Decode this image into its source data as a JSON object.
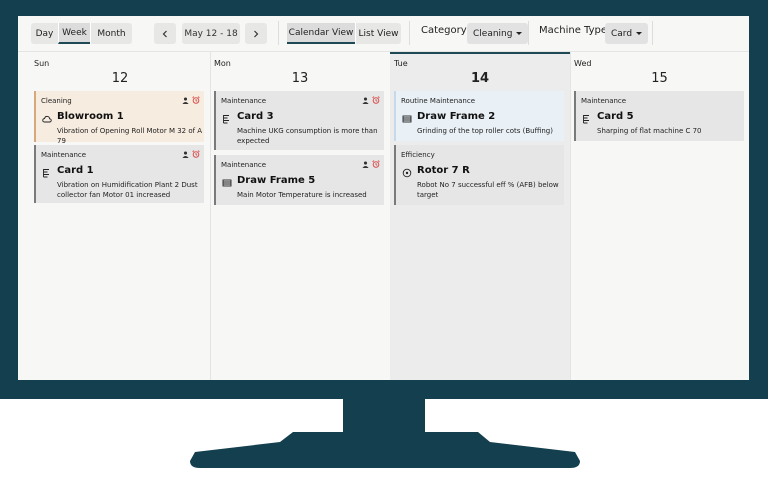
{
  "toolbar": {
    "view_range": [
      "Day",
      "Week",
      "Month"
    ],
    "date_range": "May 12 -  18",
    "view_modes": [
      "Calendar View",
      "List View"
    ],
    "category_label": "Category:",
    "category_value": "Cleaning",
    "machine_type_label": "Machine Type:",
    "machine_type_value": "Card"
  },
  "days": [
    {
      "name": "Sun",
      "number": "12",
      "cards": [
        {
          "category": "Cleaning",
          "title": "Blowroom 1",
          "description": "Vibration of Opening Roll Motor M 32 of A 79",
          "icon": "cloud-icon"
        },
        {
          "category": "Maintenance",
          "title": "Card 1",
          "description": "Vibration on Humidification Plant 2 Dust collector fan Motor 01 increased",
          "icon": "card-machine-icon"
        }
      ]
    },
    {
      "name": "Mon",
      "number": "13",
      "cards": [
        {
          "category": "Maintenance",
          "title": "Card 3",
          "description": "Machine UKG consumption is more than expected",
          "icon": "card-machine-icon"
        },
        {
          "category": "Maintenance",
          "title": "Draw Frame 5",
          "description": "Main Motor Temperature is increased",
          "icon": "draw-frame-icon"
        }
      ]
    },
    {
      "name": "Tue",
      "number": "14",
      "cards": [
        {
          "category": "Routine Maintenance",
          "title": "Draw Frame 2",
          "description": "Grinding of the top roller cots (Buffing)",
          "icon": "draw-frame-icon"
        },
        {
          "category": "Efficiency",
          "title": "Rotor 7 R",
          "description": "Robot No 7 successful eff % (AFB) below target",
          "icon": "rotor-icon"
        }
      ]
    },
    {
      "name": "Wed",
      "number": "15",
      "cards": [
        {
          "category": "Maintenance",
          "title": "Card 5",
          "description": "Sharping of flat machine C 70",
          "icon": "card-machine-icon"
        }
      ]
    }
  ],
  "colors": {
    "monitor": "#133f4e",
    "accent": "#1f4a55",
    "alarm": "#d9534f"
  }
}
